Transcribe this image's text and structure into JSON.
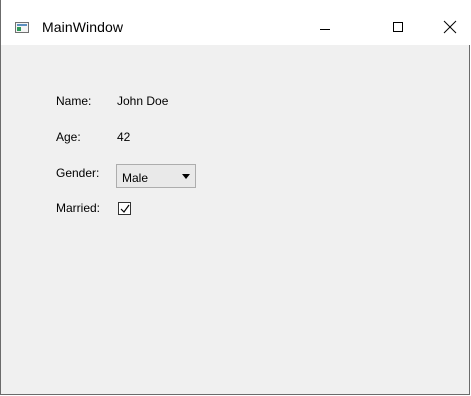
{
  "window": {
    "title": "MainWindow"
  },
  "form": {
    "name_label": "Name:",
    "name_value": "John Doe",
    "age_label": "Age:",
    "age_value": "42",
    "gender_label": "Gender:",
    "gender_selected": "Male",
    "married_label": "Married:",
    "married_checked": true
  },
  "icons": {
    "app": "window-app-icon",
    "minimize": "minimize-icon",
    "maximize": "maximize-icon",
    "close": "close-icon",
    "dropdown": "chevron-down-icon",
    "check": "checkmark-icon"
  },
  "colors": {
    "titlebar_bg": "#ffffff",
    "client_bg": "#f0f0f0",
    "combo_bg": "#e9e9e9",
    "combo_border": "#adadad"
  }
}
